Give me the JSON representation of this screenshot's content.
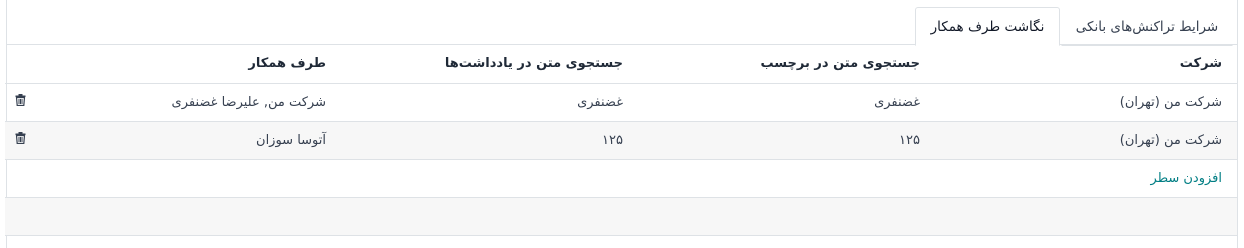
{
  "tabs": [
    {
      "label": "شرایط تراکنش‌های بانکی",
      "active": false
    },
    {
      "label": "نگاشت طرف همکار",
      "active": true
    }
  ],
  "table": {
    "headers": {
      "company": "شرکت",
      "label_search": "جستجوی متن در برچسب",
      "note_search": "جستجوی متن در یادداشت‌ها",
      "partner": "طرف همکار"
    },
    "rows": [
      {
        "company": "شرکت من (تهران)",
        "label_search": "غضنفری",
        "note_search": "غضنفری",
        "partner": "شرکت من, علیرضا غضنفری"
      },
      {
        "company": "شرکت من (تهران)",
        "label_search": "۱۲۵",
        "note_search": "۱۲۵",
        "partner": "آتوسا سوزان"
      }
    ],
    "add_line": "افزودن سطر"
  },
  "colors": {
    "accent": "#017e84",
    "border": "#dee2e6",
    "row_alt": "#f7f7f7"
  },
  "icons": {
    "delete": "trash-icon"
  }
}
